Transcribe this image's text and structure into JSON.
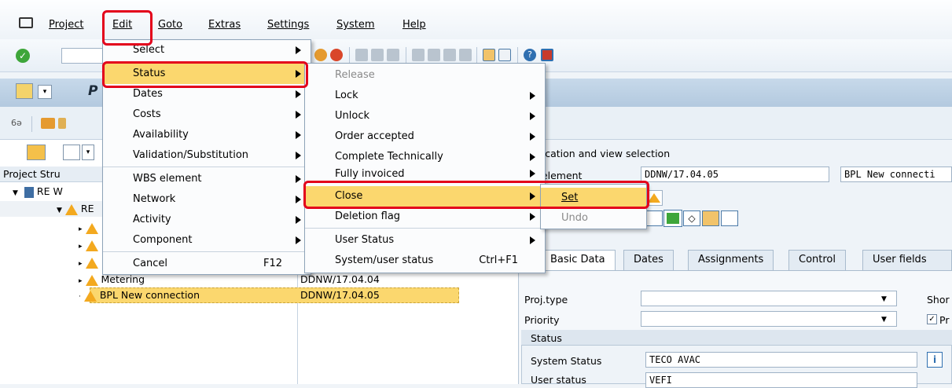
{
  "menubar": {
    "items": [
      "Project",
      "Edit",
      "Goto",
      "Extras",
      "Settings",
      "System",
      "Help"
    ]
  },
  "toolbar": {
    "command_field": ""
  },
  "title": {
    "letter": "P"
  },
  "edit_menu": {
    "items": [
      {
        "label": "Select",
        "submenu": true
      },
      {
        "label": "Status",
        "submenu": true,
        "highlighted": true
      },
      {
        "label": "Dates",
        "submenu": true
      },
      {
        "label": "Costs",
        "submenu": true
      },
      {
        "label": "Availability",
        "submenu": true
      },
      {
        "label": "Validation/Substitution",
        "submenu": true
      },
      {
        "label": "WBS element",
        "submenu": true
      },
      {
        "label": "Network",
        "submenu": true
      },
      {
        "label": "Activity",
        "submenu": true
      },
      {
        "label": "Component",
        "submenu": true
      },
      {
        "label": "Cancel",
        "shortcut": "F12"
      }
    ]
  },
  "status_menu": {
    "items": [
      {
        "label": "Release",
        "disabled": true
      },
      {
        "label": "Lock",
        "submenu": true
      },
      {
        "label": "Unlock",
        "submenu": true
      },
      {
        "label": "Order accepted",
        "submenu": true
      },
      {
        "label": "Complete Technically",
        "submenu": true
      },
      {
        "label": "Fully invoiced",
        "submenu": true
      },
      {
        "label": "Close",
        "submenu": true,
        "highlighted": true
      },
      {
        "label": "Deletion flag",
        "submenu": true
      },
      {
        "label": "User Status",
        "submenu": true
      },
      {
        "label": "System/user status",
        "shortcut": "Ctrl+F1"
      }
    ]
  },
  "close_menu": {
    "items": [
      {
        "label": "Set",
        "highlighted": true
      },
      {
        "label": "Undo",
        "disabled": true
      }
    ]
  },
  "tree": {
    "header": "Project Stru",
    "rows": [
      {
        "label": "RE W",
        "code": ""
      },
      {
        "label": "RE",
        "code": ""
      },
      {
        "label": "Metering",
        "code": "DDNW/17.04.04"
      },
      {
        "label": "BPL New connection",
        "code": "DDNW/17.04.05"
      }
    ]
  },
  "right": {
    "section_title": "tification and view selection",
    "wbs_label": "S element",
    "wbs_value": "DDNW/17.04.05",
    "wbs_desc": "BPL New connecti",
    "tabs": [
      "Basic Data",
      "Dates",
      "Assignments",
      "Control",
      "User fields"
    ],
    "proj_type_label": "Proj.type",
    "priority_label": "Priority",
    "short_label": "Shor",
    "pr_label": "Pr",
    "status_group": "Status",
    "system_status_label": "System Status",
    "system_status_value": "TECO AVAC",
    "user_status_label": "User status",
    "user_status_value": "VEFI"
  },
  "colors": {
    "highlight": "#fbd76e",
    "callout": "#e3001b",
    "warning": "#f3a91f"
  }
}
